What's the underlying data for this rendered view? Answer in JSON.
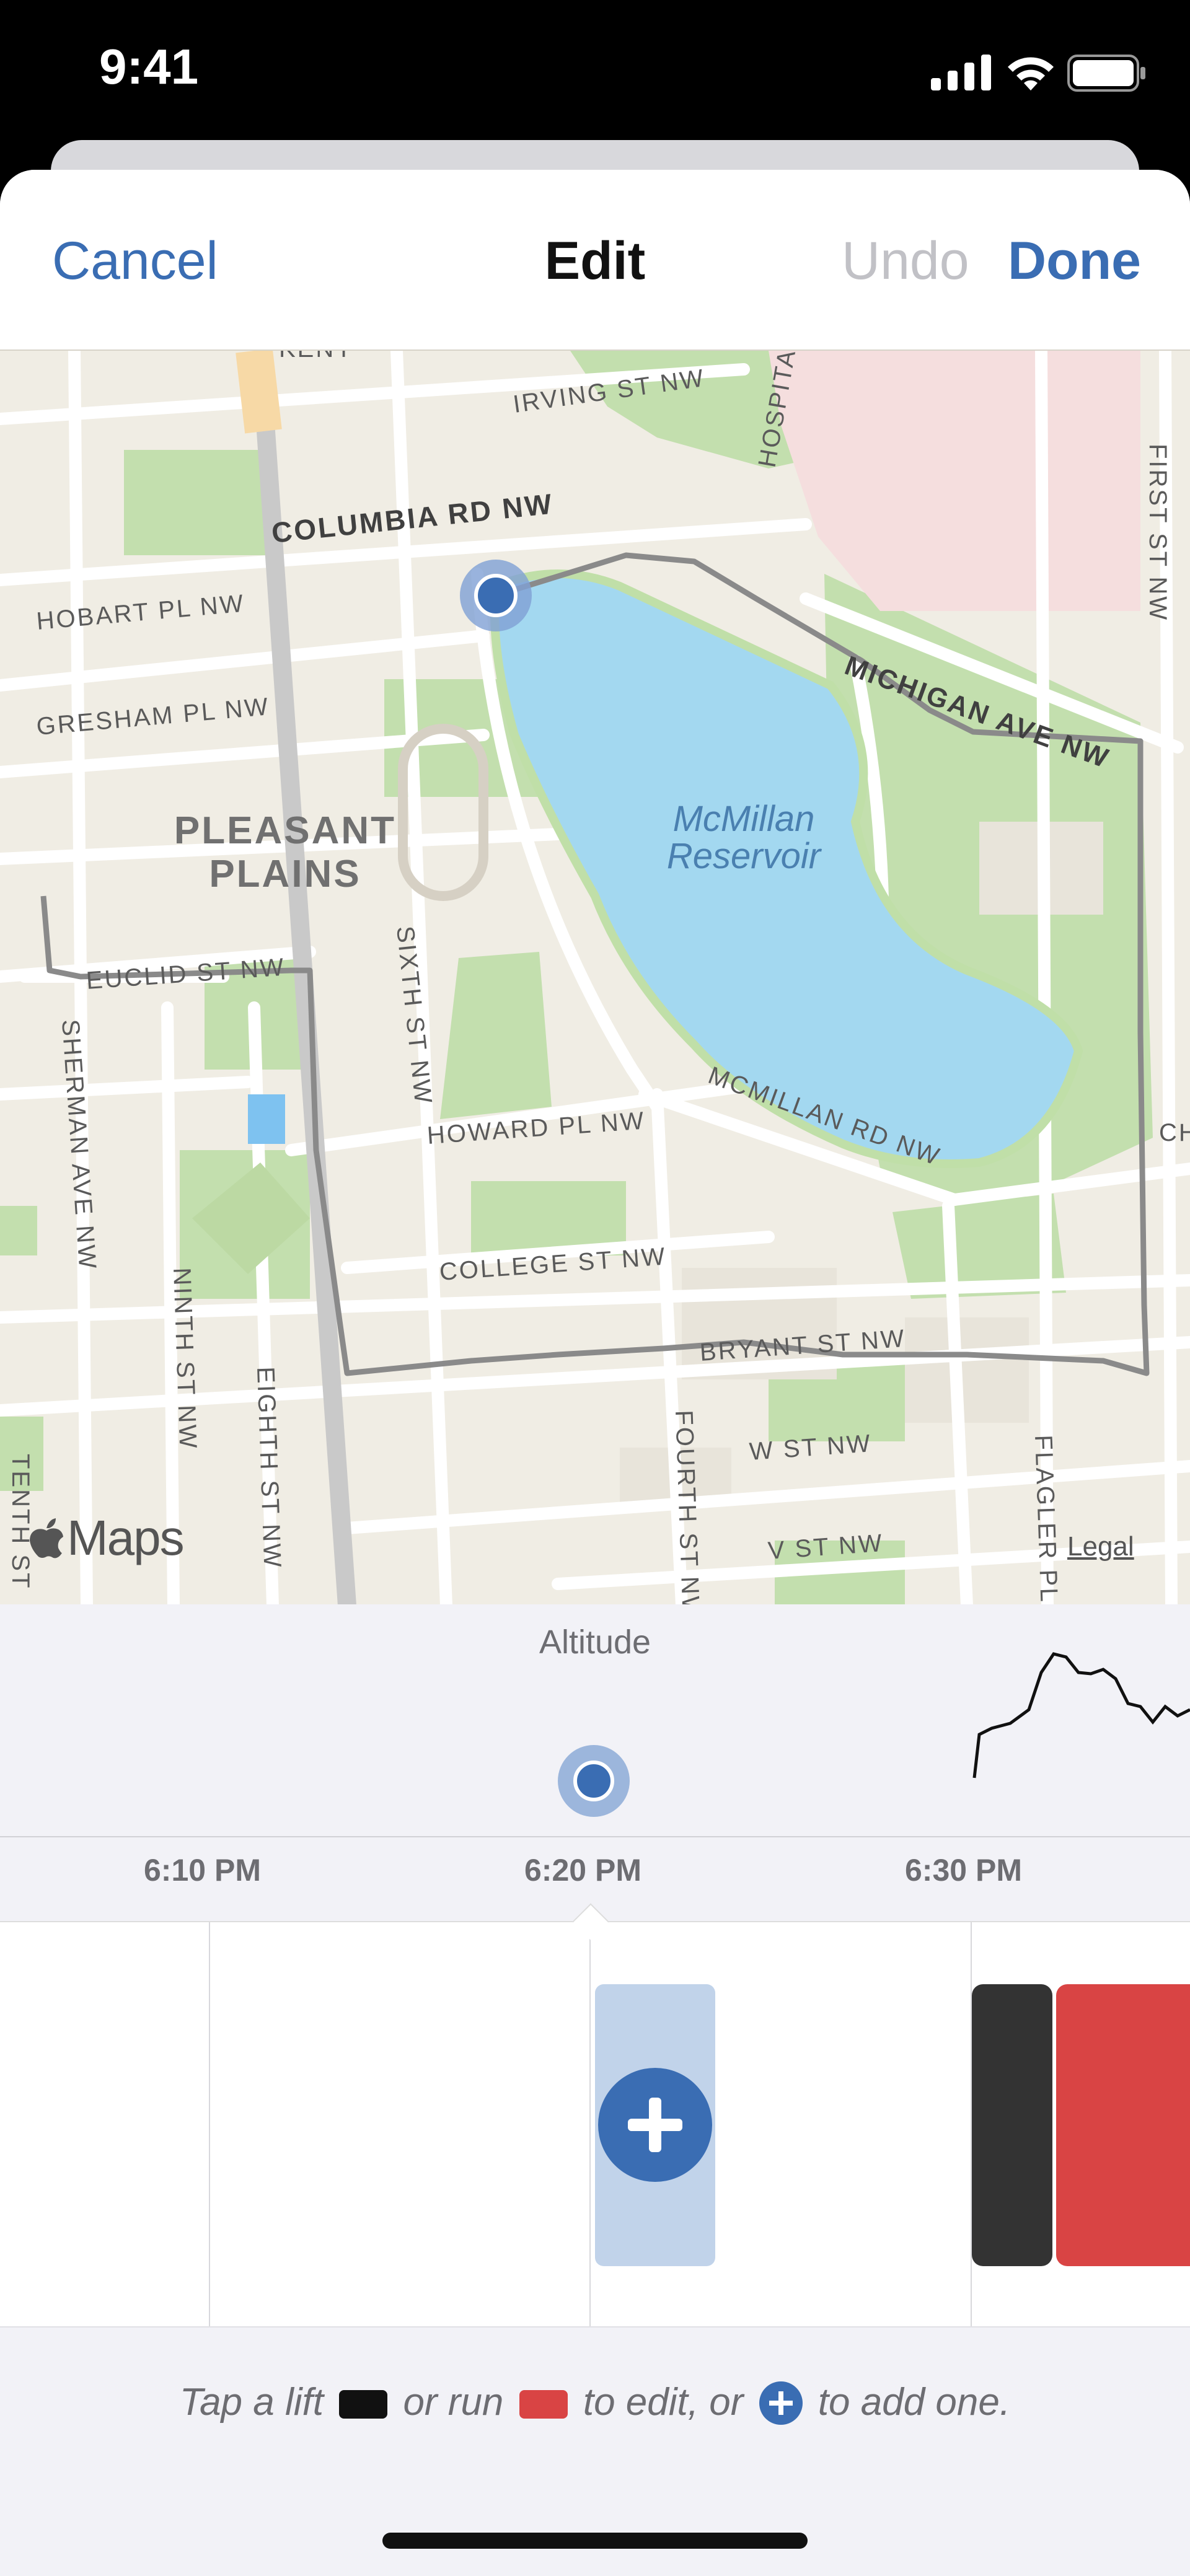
{
  "status_bar": {
    "time": "9:41"
  },
  "nav": {
    "cancel": "Cancel",
    "title": "Edit",
    "undo": "Undo",
    "done": "Done"
  },
  "map": {
    "labels": {
      "kenyon": "KENY",
      "irving": "IRVING ST NW",
      "hospital": "HOSPITAL",
      "columbia": "COLUMBIA RD NW",
      "first": "FIRST ST NW",
      "hobart": "HOBART PL NW",
      "gresham": "GRESHAM PL NW",
      "michigan": "MICHIGAN AVE NW",
      "pleasant1": "PLEASANT",
      "pleasant2": "PLAINS",
      "reservoir1": "McMillan",
      "reservoir2": "Reservoir",
      "euclid": "EUCLID ST NW",
      "sixth": "SIXTH ST NW",
      "sherman": "SHERMAN AVE NW",
      "howard": "HOWARD PL NW",
      "mcmillanrd": "MCMILLAN RD NW",
      "ninth": "NINTH ST NW",
      "college": "COLLEGE ST NW",
      "eighth": "EIGHTH ST NW",
      "bryant": "BRYANT ST NW",
      "tenth": "TENTH ST",
      "w_st": "W ST NW",
      "fourth": "FOURTH ST NW",
      "flagler": "FLAGLER PL",
      "v_st": "V ST NW",
      "ch": "CH",
      "legal": "Legal"
    },
    "brand": "Maps"
  },
  "chart": {
    "title": "Altitude",
    "ticks": [
      "6:10 PM",
      "6:20 PM",
      "6:30 PM"
    ]
  },
  "footer": {
    "hint_part1": "Tap a lift",
    "hint_part2": "or run",
    "hint_part3": "to edit, or",
    "hint_part4": "to add one."
  },
  "colors": {
    "accent": "#3a6db3",
    "lift": "#333333",
    "run": "#d94444",
    "water": "#a3d8f0",
    "park": "#c3dfae"
  }
}
